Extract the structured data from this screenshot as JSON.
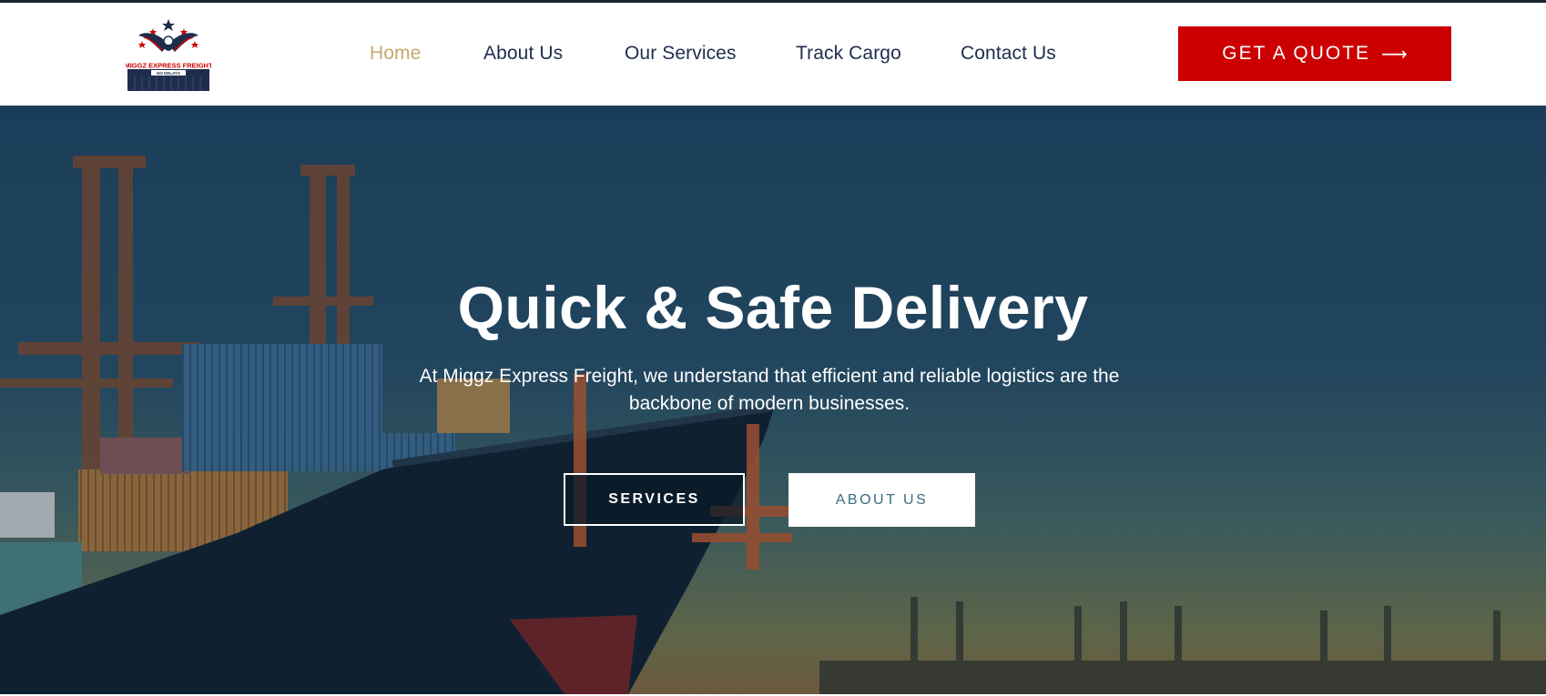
{
  "header": {
    "logo": {
      "brand_text": "MIGGZ EXPRESS FREIGHT",
      "tagline": "NO DELAYS",
      "brand_color": "#cc0000",
      "navy_color": "#1f2d4d"
    },
    "nav": [
      {
        "label": "Home",
        "active": true
      },
      {
        "label": "About Us",
        "active": false
      },
      {
        "label": "Our Services",
        "active": false
      },
      {
        "label": "Track Cargo",
        "active": false
      },
      {
        "label": "Contact Us",
        "active": false
      }
    ],
    "quote_button": {
      "label": "GET A QUOTE",
      "icon": "arrow-right-icon",
      "color": "#cc0000"
    }
  },
  "hero": {
    "title": "Quick & Safe Delivery",
    "subtitle": "At Miggz Express Freight, we understand that efficient and reliable logistics are the backbone of modern businesses.",
    "buttons": {
      "services": "SERVICES",
      "about": "ABOUT US"
    },
    "background": "cargo-ship-port-photo"
  },
  "colors": {
    "nav_active": "#c8a96a",
    "nav_text": "#1f2d4d",
    "accent_red": "#cc0000"
  }
}
